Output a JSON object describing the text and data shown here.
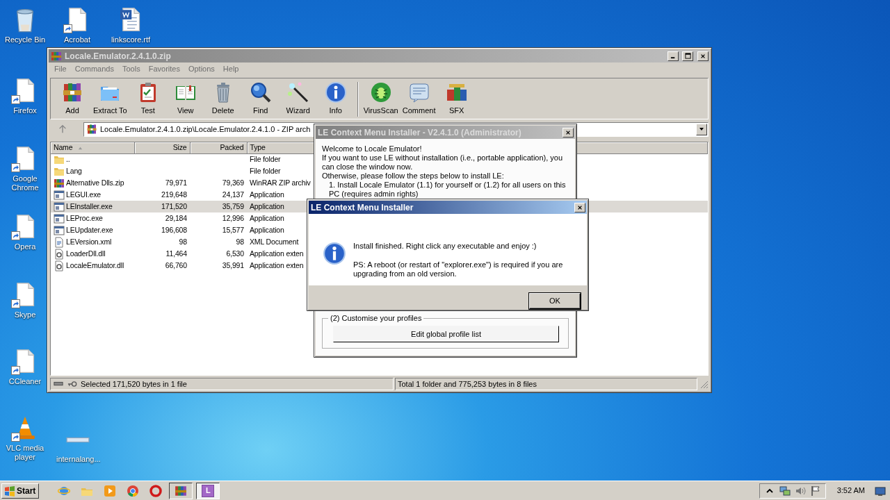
{
  "desktop_icons": [
    {
      "label": "Recycle Bin",
      "kind": "recycle",
      "shortcut": false
    },
    {
      "label": "Acrobat",
      "kind": "blank",
      "shortcut": true
    },
    {
      "label": "linkscore.rtf",
      "kind": "word",
      "shortcut": false
    },
    {
      "label": "Firefox",
      "kind": "blank",
      "shortcut": true
    },
    {
      "label": "Google Chrome",
      "kind": "blank",
      "shortcut": true
    },
    {
      "label": "Opera",
      "kind": "blank",
      "shortcut": true
    },
    {
      "label": "Skype",
      "kind": "blank",
      "shortcut": true
    },
    {
      "label": "CCleaner",
      "kind": "blank",
      "shortcut": true
    },
    {
      "label": "VLC media player",
      "kind": "vlc",
      "shortcut": true
    },
    {
      "label": "internalang...",
      "kind": "flat",
      "shortcut": false
    }
  ],
  "archive_window": {
    "title": "Locale.Emulator.2.4.1.0.zip",
    "active": false,
    "menu": [
      "File",
      "Commands",
      "Tools",
      "Favorites",
      "Options",
      "Help"
    ],
    "toolbar": [
      {
        "label": "Add",
        "kind": "add",
        "separated": false
      },
      {
        "label": "Extract To",
        "kind": "extract",
        "separated": false
      },
      {
        "label": "Test",
        "kind": "test",
        "separated": false
      },
      {
        "label": "View",
        "kind": "view",
        "separated": false
      },
      {
        "label": "Delete",
        "kind": "delete",
        "separated": false
      },
      {
        "label": "Find",
        "kind": "find",
        "separated": false
      },
      {
        "label": "Wizard",
        "kind": "wizard",
        "separated": false
      },
      {
        "label": "Info",
        "kind": "info",
        "separated": false
      },
      {
        "label": "VirusScan",
        "kind": "virus",
        "separated": true
      },
      {
        "label": "Comment",
        "kind": "comment",
        "separated": false
      },
      {
        "label": "SFX",
        "kind": "sfx",
        "separated": false
      }
    ],
    "address": "Locale.Emulator.2.4.1.0.zip\\Locale.Emulator.2.4.1.0 - ZIP arch",
    "table": {
      "columns": [
        "Name",
        "Size",
        "Packed",
        "Type"
      ],
      "rows": [
        {
          "name": "..",
          "type": "File folder",
          "kind": "folder",
          "selected": false
        },
        {
          "name": "Lang",
          "type": "File folder",
          "kind": "folder",
          "selected": false
        },
        {
          "name": "Alternative Dlls.zip",
          "size": "79,971",
          "packed": "79,369",
          "type": "WinRAR ZIP archiv",
          "kind": "zip",
          "selected": false
        },
        {
          "name": "LEGUI.exe",
          "size": "219,648",
          "packed": "24,137",
          "type": "Application",
          "kind": "exe",
          "selected": false
        },
        {
          "name": "LEInstaller.exe",
          "size": "171,520",
          "packed": "35,759",
          "type": "Application",
          "kind": "exe",
          "selected": true
        },
        {
          "name": "LEProc.exe",
          "size": "29,184",
          "packed": "12,996",
          "type": "Application",
          "kind": "exe",
          "selected": false
        },
        {
          "name": "LEUpdater.exe",
          "size": "196,608",
          "packed": "15,577",
          "type": "Application",
          "kind": "exe",
          "selected": false
        },
        {
          "name": "LEVersion.xml",
          "size": "98",
          "packed": "98",
          "type": "XML Document",
          "kind": "xml",
          "selected": false
        },
        {
          "name": "LoaderDll.dll",
          "size": "11,464",
          "packed": "6,530",
          "type": "Application exten",
          "kind": "dll",
          "selected": false
        },
        {
          "name": "LocaleEmulator.dll",
          "size": "66,760",
          "packed": "35,991",
          "type": "Application exten",
          "kind": "dll",
          "selected": false
        }
      ]
    },
    "status_bar": {
      "left": "Selected 171,520 bytes in 1 file",
      "right": "Total 1 folder and 775,253 bytes in 8 files"
    }
  },
  "installer_window": {
    "title": "LE Context Menu Installer - V2.4.1.0 (Administrator)",
    "active": false,
    "welcome": "Welcome to Locale Emulator!",
    "intro": "If you want to use LE without installation (i.e., portable application), you can close the window now.",
    "instructions": "Otherwise, please follow the steps below to install LE:",
    "step": "1. Install Locale Emulator (1.1) for yourself or (1.2) for all users on this PC (requires admin rights)",
    "group_label": "(2) Customise your profiles",
    "group_button": "Edit global profile list"
  },
  "message_dialog": {
    "title": "LE Context Menu Installer",
    "active": true,
    "message": "Install finished. Right click any executable and enjoy :)",
    "note": "PS: A reboot (or restart of \"explorer.exe\") is required if you are upgrading from an old version.",
    "button": "OK"
  },
  "taskbar": {
    "start": "Start",
    "items": [
      {
        "kind": "ie",
        "running": false,
        "selected": false
      },
      {
        "kind": "explorer",
        "running": false,
        "selected": false
      },
      {
        "kind": "player",
        "running": false,
        "selected": false
      },
      {
        "kind": "chrome",
        "running": false,
        "selected": false
      },
      {
        "kind": "opera",
        "running": false,
        "selected": false
      },
      {
        "kind": "winrar",
        "running": true,
        "selected": false
      },
      {
        "kind": "le",
        "glyph": "L",
        "running": true,
        "selected": true
      }
    ],
    "clock": "3:52 AM"
  }
}
